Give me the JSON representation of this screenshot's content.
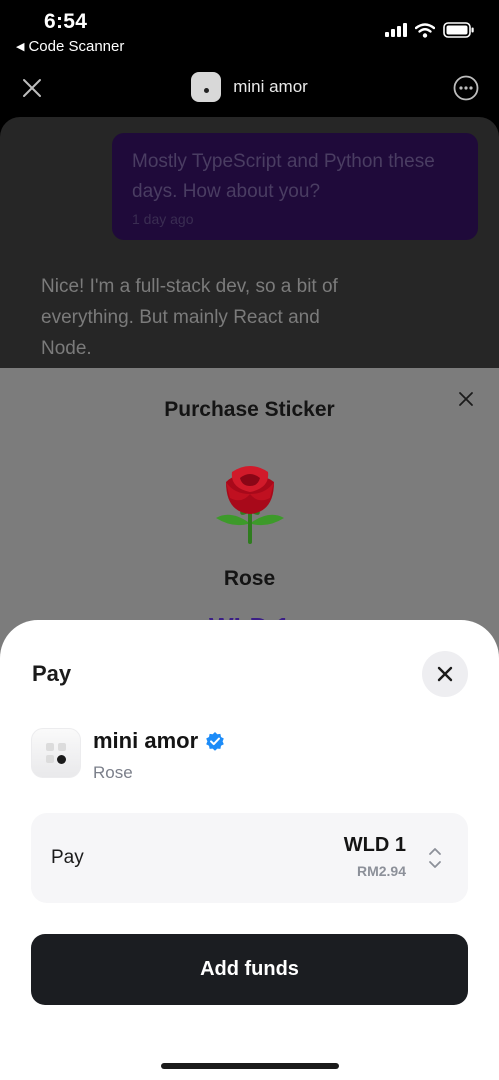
{
  "status_bar": {
    "time": "6:54",
    "back_app": "Code Scanner",
    "icons": [
      "signal-icon",
      "wifi-icon",
      "battery-icon"
    ]
  },
  "header": {
    "title": "mini amor",
    "close_icon": "close-icon",
    "more_icon": "more-options-icon"
  },
  "chat": {
    "outgoing": {
      "text": "Mostly TypeScript and Python these days. How about you?",
      "timestamp": "1 day ago"
    },
    "incoming": {
      "text": "Nice! I'm a full-stack dev, so a bit of everything. But mainly React and Node."
    }
  },
  "sticker_sheet": {
    "title": "Purchase Sticker",
    "name": "Rose",
    "price": "WLD 1"
  },
  "pay_sheet": {
    "title": "Pay",
    "merchant_name": "mini amor",
    "merchant_verified": true,
    "item": "Rose",
    "pay_label": "Pay",
    "amount": "WLD 1",
    "local_amount": "RM2.94",
    "button_label": "Add funds"
  },
  "colors": {
    "verified_badge": "#1d8cf8",
    "button_bg": "#1b1d21",
    "sticker_price": "#3b1e86",
    "outgoing_bubble": "#1f0a3a"
  }
}
